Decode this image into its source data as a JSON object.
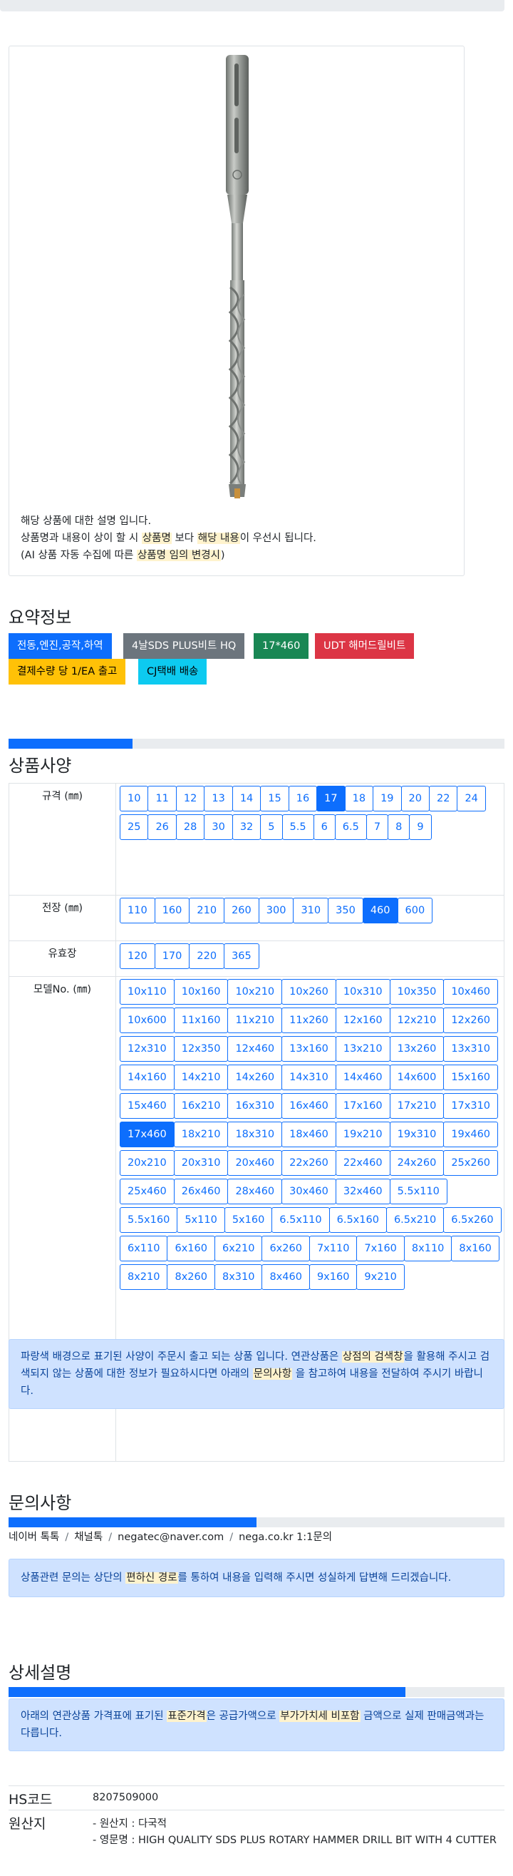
{
  "image_caption": {
    "line1": "해당 상품에 대한 설명 입니다.",
    "line2_a": "상품명과 내용이 상이 할 시",
    "line2_hl1": "상품명",
    "line2_b": "보다",
    "line2_hl2": "해당 내용",
    "line2_c": "이 우선시 됩니다.",
    "line3_a": "(AI 상품 자동 수집에 따른",
    "line3_hl": "상품명 임의 변경시",
    "line3_b": ")"
  },
  "summary": {
    "title": "요약정보",
    "tags": [
      "전동,엔진,공작,하역",
      "4날SDS PLUS비트 HQ",
      "17*460",
      "UDT 해머드릴비트",
      "결제수량 당 1/EA 출고",
      "CJ택배 배송"
    ]
  },
  "spec": {
    "title": "상품사양",
    "progress": 0.25,
    "rows": [
      {
        "label": "규격 (㎜)",
        "options": [
          "10",
          "11",
          "12",
          "13",
          "14",
          "15",
          "16",
          "17",
          "18",
          "19",
          "20",
          "22",
          "24",
          "25",
          "26",
          "28",
          "30",
          "32",
          "5",
          "5.5",
          "6",
          "6.5",
          "7",
          "8",
          "9"
        ],
        "selected": "17"
      },
      {
        "label": "전장 (㎜)",
        "options": [
          "110",
          "160",
          "210",
          "260",
          "300",
          "310",
          "350",
          "460",
          "600"
        ],
        "selected": "460"
      },
      {
        "label": "유효장",
        "options": [
          "120",
          "170",
          "220",
          "365"
        ],
        "selected": ""
      },
      {
        "label": "모델No. (㎜)",
        "options": [
          "10x110",
          "10x160",
          "10x210",
          "10x260",
          "10x310",
          "10x350",
          "10x460",
          "10x600",
          "11x160",
          "11x210",
          "11x260",
          "12x160",
          "12x210",
          "12x260",
          "12x310",
          "12x350",
          "12x460",
          "13x160",
          "13x210",
          "13x260",
          "13x310",
          "14x160",
          "14x210",
          "14x260",
          "14x310",
          "14x460",
          "14x600",
          "15x160",
          "15x460",
          "16x210",
          "16x310",
          "16x460",
          "17x160",
          "17x210",
          "17x310",
          "17x460",
          "18x210",
          "18x310",
          "18x460",
          "19x210",
          "19x310",
          "19x460",
          "20x210",
          "20x310",
          "20x460",
          "22x260",
          "22x460",
          "24x260",
          "25x260",
          "25x460",
          "26x460",
          "28x460",
          "30x460",
          "32x460",
          "5.5x110",
          "5.5x160",
          "5x110",
          "5x160",
          "6.5x110",
          "6.5x160",
          "6.5x210",
          "6.5x260",
          "6x110",
          "6x160",
          "6x210",
          "6x260",
          "7x110",
          "7x160",
          "8x110",
          "8x160",
          "8x210",
          "8x260",
          "8x310",
          "8x460",
          "9x160",
          "9x210"
        ],
        "selected": "17x460"
      }
    ],
    "notice_a": "파랑색 배경으로 표기된 사양이 주문시 출고 되는 상품 입니다. 연관상품은",
    "notice_hl1": "상점의 검색창",
    "notice_b": "을 활용해 주시고 검색되지 않는 상품에 대한 정보가 필요하시다면 아래의",
    "notice_hl2": "문의사항",
    "notice_c": "을 참고하여 내용을 전달하여 주시기 바랍니다."
  },
  "inquiry": {
    "title": "문의사항",
    "progress": 0.5,
    "channels": [
      "네이버 톡톡",
      "채널톡",
      "negatec@naver.com",
      "nega.co.kr 1:1문의"
    ],
    "notice_a": "상품관련 문의는 상단의",
    "notice_hl": "편하신 경로",
    "notice_b": "를 통하여 내용을 입력해 주시면 성실하게 답변해 드리겠습니다."
  },
  "detail": {
    "title": "상세설명",
    "progress": 0.8,
    "notice_a": "아래의 연관상품 가격표에 표기된",
    "notice_hl1": "표준가격",
    "notice_b": "은 공급가액으로",
    "notice_hl2": "부가가치세 비포함",
    "notice_c": "금액으로 실제 판매금액과는 다릅니다.",
    "hs_label": "HS코드",
    "hs_value": "8207509000",
    "origin_label": "원산지",
    "origin_line1": "- 원산지 : 다국적",
    "origin_line2": "- 영문명 : HIGH QUALITY SDS PLUS ROTARY HAMMER DRILL BIT WITH 4 CUTTER"
  }
}
